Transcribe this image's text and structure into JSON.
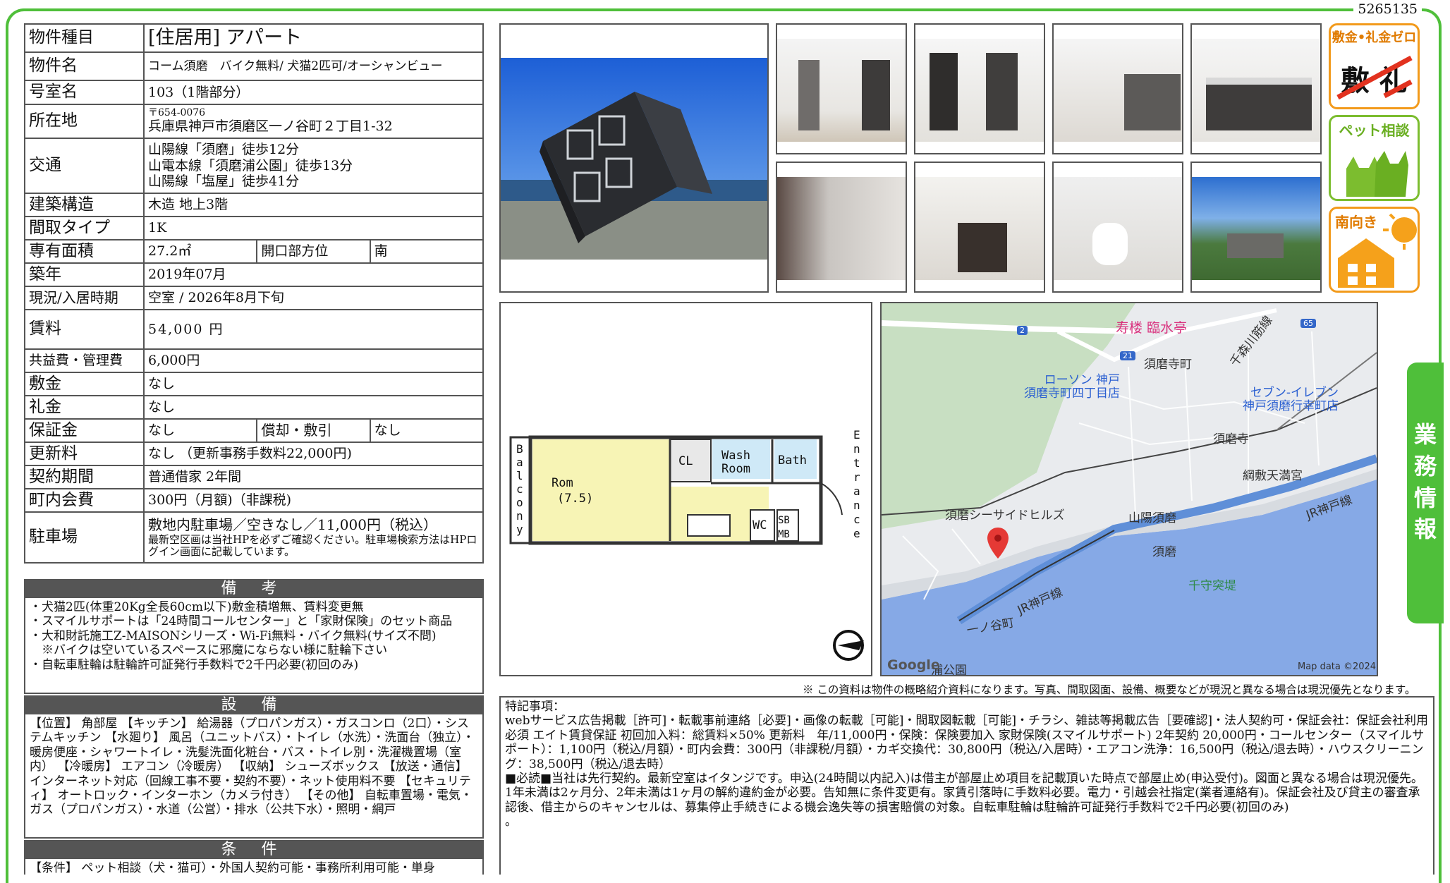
{
  "doc_id": "5265135",
  "property": {
    "rows": {
      "kind": {
        "label": "物件種目",
        "value": "[住居用]  アパート"
      },
      "name": {
        "label": "物件名",
        "value": "コーム須磨　バイク無料/ 犬猫2匹可/オーシャンビュー"
      },
      "room": {
        "label": "号室名",
        "value": "103（1階部分）"
      },
      "address": {
        "label": "所在地",
        "postal": "〒654-0076",
        "value": "兵庫県神戸市須磨区一ノ谷町２丁目1-32"
      },
      "access": {
        "label": "交通",
        "lines": [
          "山陽線「須磨」徒歩12分",
          "山電本線「須磨浦公園」徒歩13分",
          "山陽線「塩屋」徒歩41分"
        ]
      },
      "structure": {
        "label": "建築構造",
        "value": "木造 地上3階"
      },
      "layout": {
        "label": "間取タイプ",
        "value": "1K"
      },
      "area": {
        "label": "専有面積",
        "value": "27.2㎡",
        "sub_label": "開口部方位",
        "sub_value": "南"
      },
      "built": {
        "label": "築年",
        "value": "2019年07月"
      },
      "status": {
        "label": "現況/入居時期",
        "value": "空室  /  2026年8月下旬"
      },
      "rent": {
        "label": "賃料",
        "value": "54,000 円"
      },
      "fee": {
        "label": "共益費・管理費",
        "value": "6,000円"
      },
      "deposit": {
        "label": "敷金",
        "value": "なし"
      },
      "key_money": {
        "label": "礼金",
        "value": "なし"
      },
      "guarantee": {
        "label": "保証金",
        "value": "なし",
        "sub_label": "償却・敷引",
        "sub_value": "なし"
      },
      "renewal": {
        "label": "更新料",
        "value": "なし （更新事務手数料22,000円)"
      },
      "contract": {
        "label": "契約期間",
        "value": "普通借家  2年間"
      },
      "town_fee": {
        "label": "町内会費",
        "value": "300円（月額)（非課税)"
      },
      "parking": {
        "label": "駐車場",
        "value": "敷地内駐車場／空きなし／11,000円（税込）",
        "note": "最新空区画は当社HPを必ずご確認ください。駐車場検索方法はHPログイン画面に記載しています。"
      }
    }
  },
  "remarks": {
    "title": "備 考",
    "lines": [
      "・犬猫2匹(体重20Kg全長60cm以下)敷金積増無、賃料変更無",
      "・スマイルサポートは「24時間コールセンター」と「家財保険」のセット商品",
      "・大和財託施工Z-MAISONシリーズ・Wi-Fi無料・バイク無料(サイズ不問)",
      "　※バイクは空いているスペースに邪魔にならない様に駐輪下さい",
      "・自転車駐輪は駐輪許可証発行手数料で2千円必要(初回のみ)"
    ]
  },
  "facilities": {
    "title": "設 備",
    "text": "【位置】 角部屋 【キッチン】 給湯器（プロパンガス）・ガスコンロ（2口）・システムキッチン 【水廻り】 風呂（ユニットバス）・トイレ（水洗）・洗面台（独立）・暖房便座・シャワートイレ・洗髪洗面化粧台・バス・トイレ別・洗濯機置場（室内） 【冷暖房】 エアコン（冷暖房） 【収納】 シューズボックス 【放送・通信】 インターネット対応（回線工事不要・契約不要）・ネット使用料不要 【セキュリティ】 オートロック・インターホン（カメラ付き） 【その他】 自転車置場・電気・ガス（プロパンガス）・水道（公営）・排水（公共下水）・照明・網戸"
  },
  "conditions": {
    "title": "条 件",
    "text": "【条件】 ペット相談（犬・猫可）・外国人契約可能・事務所利用可能・単身"
  },
  "badges": [
    {
      "name": "no-deposit",
      "text": "敷金•礼金ゼロ",
      "sub": "敷 礼"
    },
    {
      "name": "pet",
      "text": "ペット相談"
    },
    {
      "name": "south",
      "text": "南向き"
    }
  ],
  "floorplan": {
    "balcony": "Balcony",
    "room": "Rom",
    "room_size": "(7.5)",
    "cl": "CL",
    "wash": "Wash",
    "wash2": "Room",
    "bath": "Bath",
    "wc": "WC",
    "sb": "SB",
    "mb": "MB",
    "entrance": "Entrance"
  },
  "map": {
    "labels": {
      "jurou": "寿楼 臨水亭",
      "sumadera": "須磨寺町",
      "lawson1": "ローソン 神戸",
      "lawson2": "須磨寺町四丁目店",
      "seven1": "セブン-イレブン",
      "seven2": "神戸須磨行幸町店",
      "sumadera_st": "須磨寺",
      "tenmangu": "綱敷天満宮",
      "seaside": "須磨シーサイドヒルズ",
      "sanyo_suma": "山陽須磨",
      "suma": "須磨",
      "jr_kobe": "JR神戸線",
      "jr_kobe2": "JR神戸線",
      "senju": "千守突堤",
      "ichinotani": "一ノ谷町",
      "koen": "浦公園",
      "chitose": "千森川筋線",
      "google": "Google",
      "mapdata": "Map data ©2024",
      "route2": "2",
      "route21": "21",
      "route65": "65"
    }
  },
  "disclaimer": "※ この資料は物件の概略紹介資料になります。写真、間取図面、設備、概要などが現況と異なる場合は現況優先となります。",
  "special": {
    "title": "特記事項：",
    "p1": "webサービス広告掲載［許可]・転載事前連絡［必要]・画像の転載［可能]・間取図転載［可能]・チラシ、雑誌等掲載広告［要確認]・法人契約可・保証会社：保証会社利用必須 エイト賃貸保証 初回加入料：総賃料×50% 更新料　年/11,000円・保険：保険要加入 家財保険(スマイルサポート) 2年契約 20,000円・コールセンター（スマイルサポート）：1,100円（税込/月額）・町内会費：300円（非課税/月額）・カギ交換代：30,800円（税込/入居時）・エアコン洗浄：16,500円（税込/退去時）・ハウスクリーニング：38,500円（税込/退去時）",
    "p2": "■必読■当社は先行契約。最新空室はイタンジです。申込(24時間以内記入)は借主が部屋止め項目を記載頂いた時点で部屋止め(申込受付)。図面と異なる場合は現況優先。1年未満は2ヶ月分、2年未満は1ヶ月の解約違約金が必要。告知無に条件変更有。家賃引落時に手数料必要。電力・引越会社指定(業者連絡有)。保証会社及び貸主の審査承認後、借主からのキャンセルは、募集停止手続きによる機会逸失等の損害賠償の対象。自転車駐輪は駐輪許可証発行手数料で2千円必要(初回のみ)",
    "p3": "。"
  },
  "sidetab": [
    "業",
    "務",
    "情",
    "報"
  ]
}
